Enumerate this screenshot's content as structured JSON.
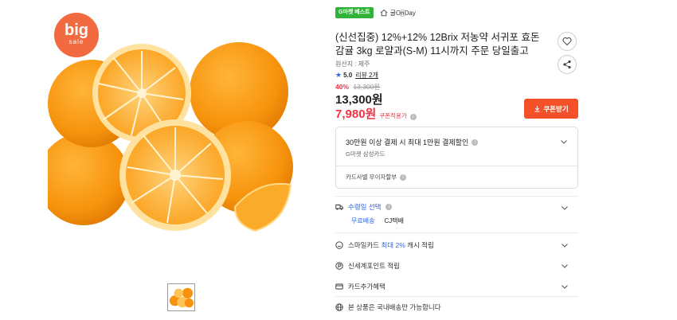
{
  "badge": {
    "big": "big",
    "sale": "sale"
  },
  "header": {
    "green_badge": "G마켓 베스트",
    "shop_name": "귤OnDay"
  },
  "product": {
    "title": "(신선집중) 12%+12% 12Brix 저농약 서귀포 효돈 감귤 3kg 로얄과(S-M) 11시까지 주문 당일출고",
    "origin": "원산지 : 제주",
    "rating_score": "5.0",
    "review_label": "리뷰 2개",
    "discount_pct": "40%",
    "original_price": "13,300원",
    "price": "13,300원",
    "coupon_price": "7,980원",
    "coupon_price_label": "쿠폰적용가",
    "coupon_button": "쿠폰받기"
  },
  "card_benefit": {
    "title": "30만원 이상 결제 시 최대 1만원 결제할인",
    "card": "G마켓 삼성카드",
    "installment": "카드사별 무이자할부"
  },
  "delivery": {
    "head": "수령일 선택",
    "free_shipping": "무료배송",
    "carrier": "CJ택배"
  },
  "benefits": [
    {
      "pre": "스마일카드 ",
      "highlight": "최대 2%",
      "post": " 캐시 적립"
    },
    {
      "pre": "신세계포인트 적립",
      "highlight": "",
      "post": ""
    },
    {
      "pre": "카드추가혜택",
      "highlight": "",
      "post": ""
    },
    {
      "pre": "본 상품은 국내배송만 가능합니다",
      "highlight": "",
      "post": ""
    }
  ],
  "colors": {
    "accent_red": "#f43142",
    "coupon_orange": "#f4502a",
    "link_blue": "#2f64e6",
    "best_green": "#31b239",
    "sale_orange": "#f26a3f"
  }
}
